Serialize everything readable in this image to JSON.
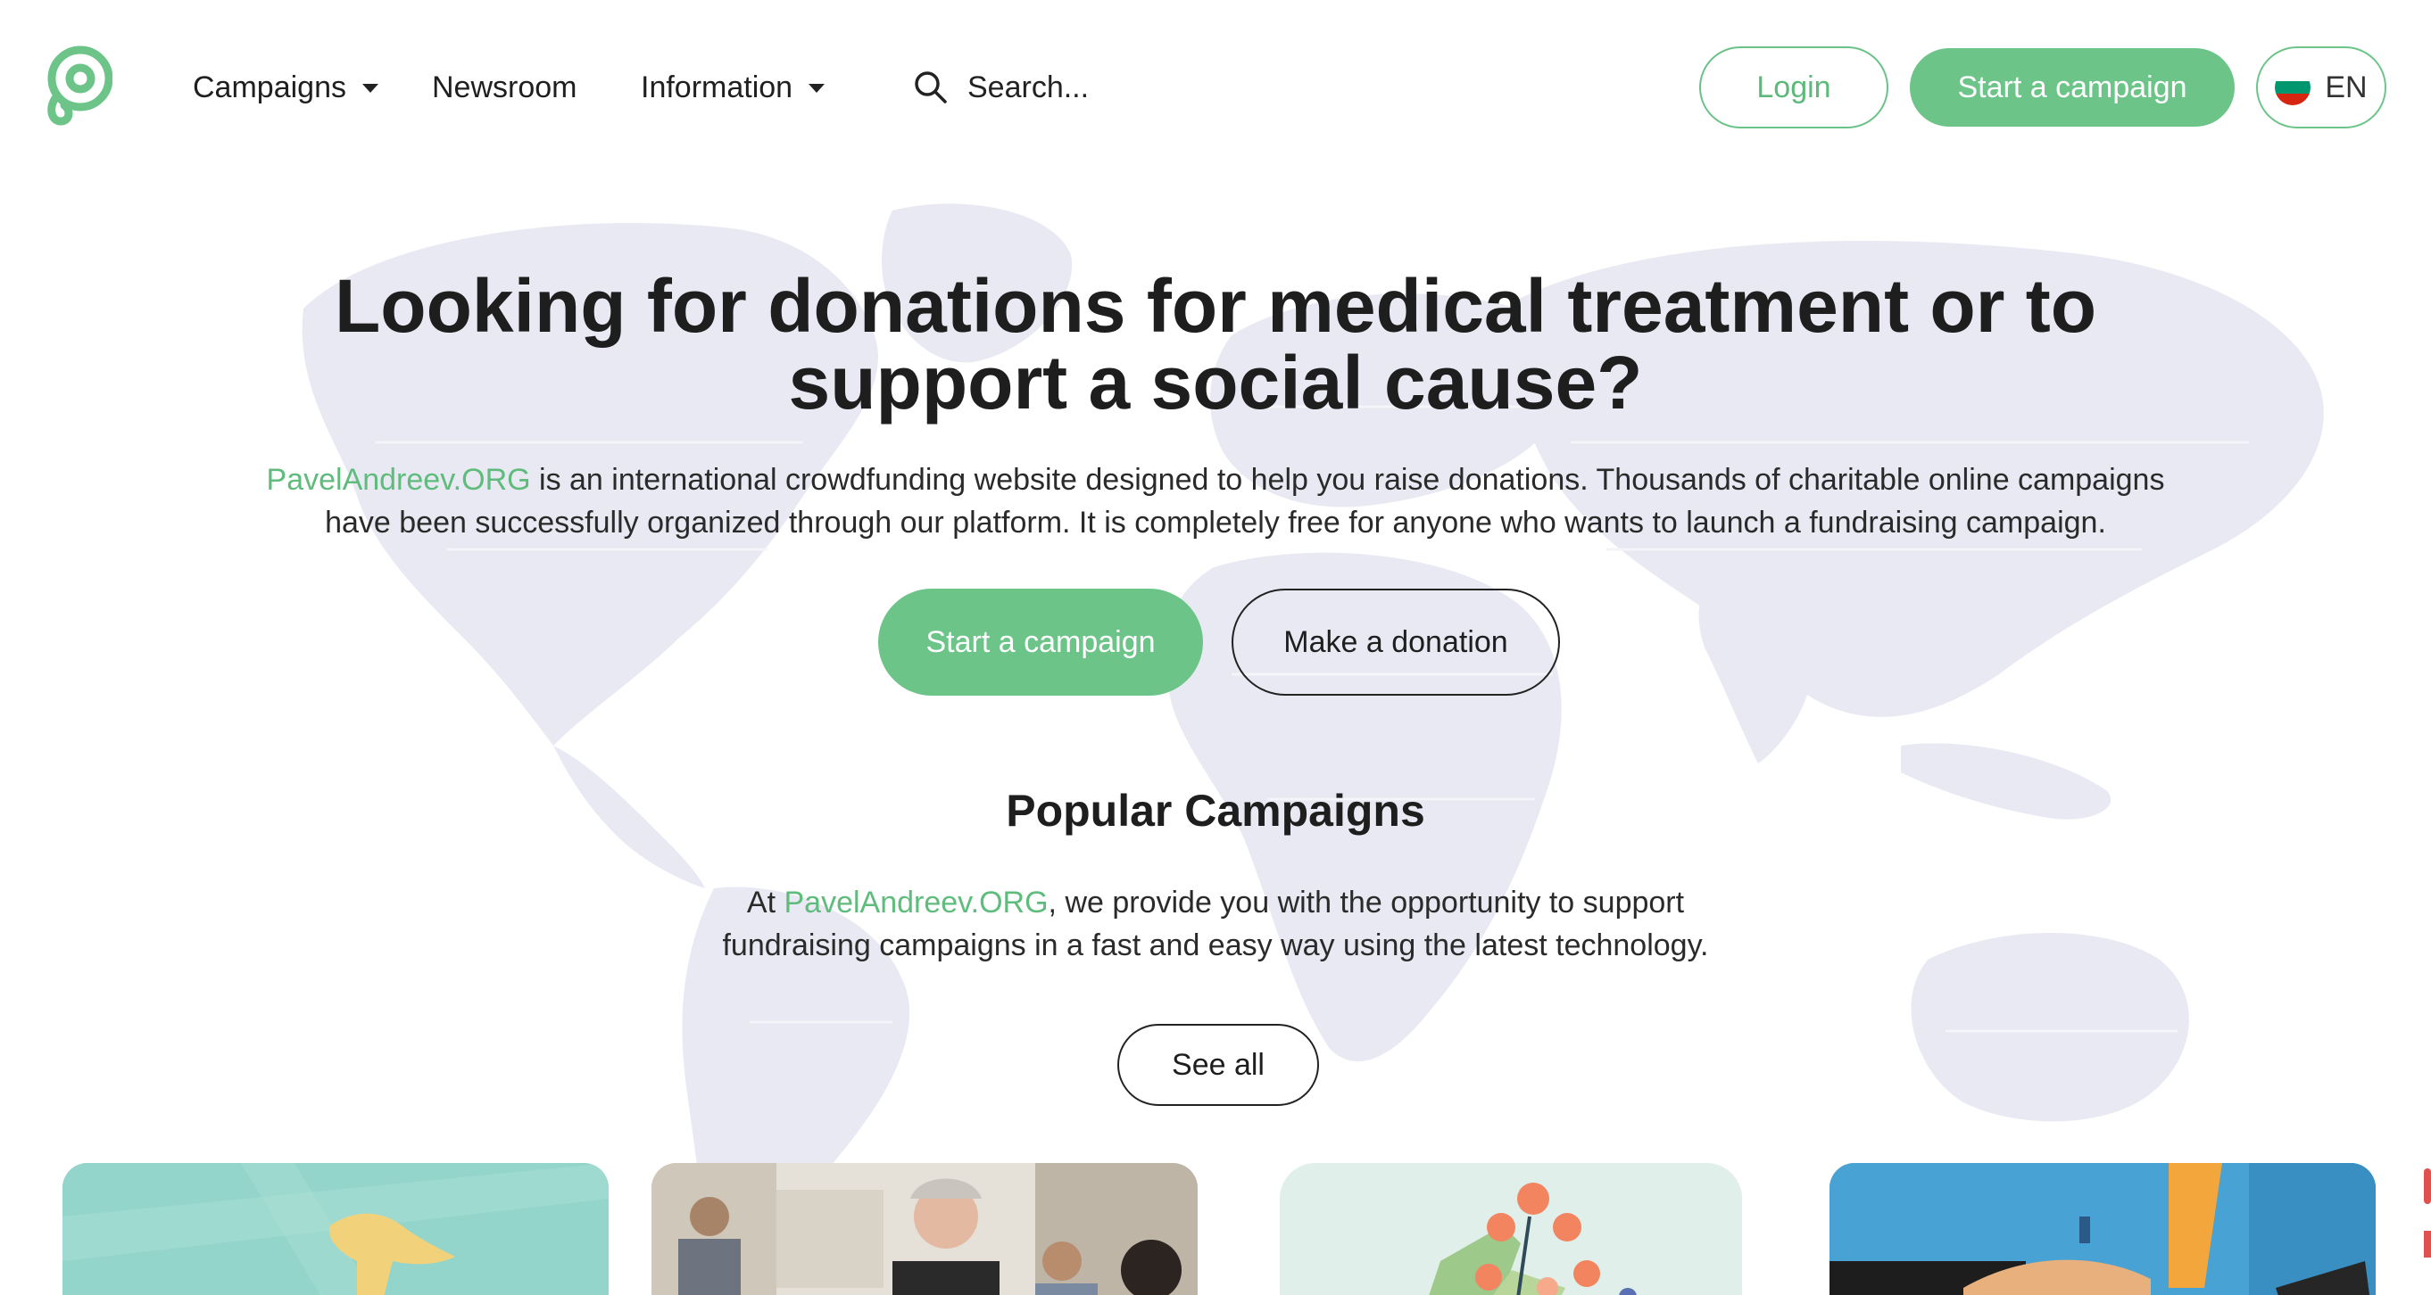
{
  "header": {
    "nav": [
      {
        "label": "Campaigns",
        "has_dropdown": true
      },
      {
        "label": "Newsroom",
        "has_dropdown": false
      },
      {
        "label": "Information",
        "has_dropdown": true
      }
    ],
    "search_placeholder": "Search...",
    "login_label": "Login",
    "start_campaign_label": "Start a campaign",
    "language": "EN"
  },
  "hero": {
    "title": "Looking for donations for medical treatment or to support a social cause?",
    "desc_brand": "PavelAndreev.ORG",
    "desc_text": " is an international crowdfunding website designed to help you raise donations. Thousands of charitable online campaigns have been successfully organized through our platform. It is completely free for anyone who wants to launch a fundraising campaign.",
    "start_label": "Start a campaign",
    "donate_label": "Make a donation"
  },
  "popular": {
    "title": "Popular Campaigns",
    "desc_prefix": "At ",
    "desc_brand": "PavelAndreev.ORG",
    "desc_text": ", we provide you with the opportunity to support fundraising campaigns in a fast and easy way using the latest technology.",
    "see_all_label": "See all"
  },
  "colors": {
    "brand_green": "#6cc488",
    "map_tint": "#e6e7f2",
    "text": "#1f1f1f"
  }
}
